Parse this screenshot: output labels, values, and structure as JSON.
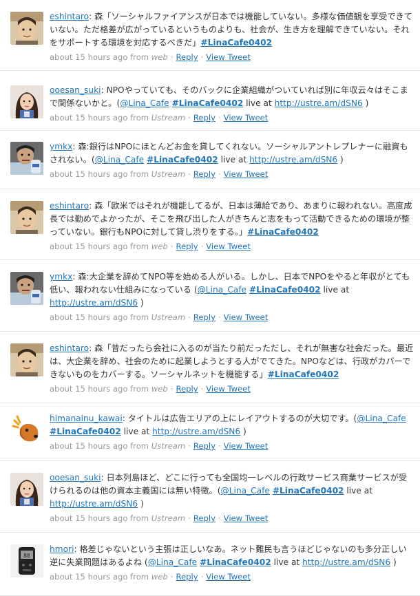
{
  "timeline": {
    "meta_labels": {
      "ago": "about 15 hours ago from",
      "reply": "Reply",
      "view": "View Tweet",
      "sep": "·"
    },
    "tweets": [
      {
        "user": "eshintaro",
        "avatar": "face-avatar",
        "text": "森「ソーシャルファイアンスが日本では機能していない。多様な価値観を享受できていない。ただ格差が広がっているというものよりも、社会が、生き方を理解できていない。それをサポートする環境を対応するべきだ」",
        "mention": "",
        "hashtag": "#LinaCafe0402",
        "live": "",
        "url": "",
        "source": "web"
      },
      {
        "user": "ooesan_suki",
        "avatar": "girl-avatar",
        "text": "NPOやっていても、そのバックに企業組織がついていれば別に年収云々はそこまで関係ないかと。(",
        "mention": "@Lina_Cafe",
        "hashtag": "#LinaCafe0402",
        "live": "live at",
        "url": "http://ustre.am/dSN6",
        "source": "Ustream"
      },
      {
        "user": "ymkx",
        "avatar": "man-avatar",
        "text": "森:銀行はNPOにほとんどお金を貸してくれない。ソーシャルアントレプレナーに融資もされない。(",
        "mention": "@Lina_Cafe",
        "hashtag": "#LinaCafe0402",
        "live": "live at",
        "url": "http://ustre.am/dSN6",
        "source": "Ustream"
      },
      {
        "user": "eshintaro",
        "avatar": "face-avatar",
        "text": "森「欧米ではそれが機能してるが、日本は薄給であり、あまりに報われない。高度成長では勤めでよかったが、そこを飛び出した人がきちんと志をもって活動できるための環境が整っていない。銀行もNPOに対して貸し渋りをする。」",
        "mention": "",
        "hashtag": "#LinaCafe0402",
        "live": "",
        "url": "",
        "source": "web"
      },
      {
        "user": "ymkx",
        "avatar": "man-avatar",
        "text": "森:大企業を辞めてNPO等を始める人がいる。しかし、日本でNPOをやると年収がとても低い、報われない仕組みになっている (",
        "mention": "@Lina_Cafe",
        "hashtag": "#LinaCafe0402",
        "live": "live at",
        "url": "http://ustre.am/dSN6",
        "source": "Ustream"
      },
      {
        "user": "eshintaro",
        "avatar": "face-avatar",
        "text": "森「昔だったら会社に入るのが当たり前だっただし、それが無害な社会だった。最近は、大企業を辞め、社会のために起業しようとする人がでてきた。NPOなどは、行政がカバーできないものをカバーする。ソーシャルネットを機能する」",
        "mention": "",
        "hashtag": "#LinaCafe0402",
        "live": "",
        "url": "",
        "source": "web"
      },
      {
        "user": "himanainu_kawai",
        "avatar": "dog-avatar",
        "text": "タイトルは広告エリアの上にレイアウトするのが大切です。(",
        "mention": "@Lina_Cafe",
        "hashtag": "#LinaCafe0402",
        "live": "live at",
        "url": "http://ustre.am/dSN6",
        "source": "Ustream"
      },
      {
        "user": "ooesan_suki",
        "avatar": "girl-avatar",
        "text": "日本列島ほど、どこに行っても全国均一レベルの行政サービス商業サービスが受けられるのは他の資本主義国には無い特徴。(",
        "mention": "@Lina_Cafe",
        "hashtag": "#LinaCafe0402",
        "live": "live at",
        "url": "http://ustre.am/dSN6",
        "source": "Ustream"
      },
      {
        "user": "hmori",
        "avatar": "device-avatar",
        "text": "格差じゃないという主張は正しいなあ。ネット難民も言うほどじゃないのも多分正しい逆に失業問題はあるよね (",
        "mention": "@Lina_Cafe",
        "hashtag": "#LinaCafe0402",
        "live": "live at",
        "url": "http://ustre.am/dSN6",
        "source": "web"
      }
    ]
  }
}
